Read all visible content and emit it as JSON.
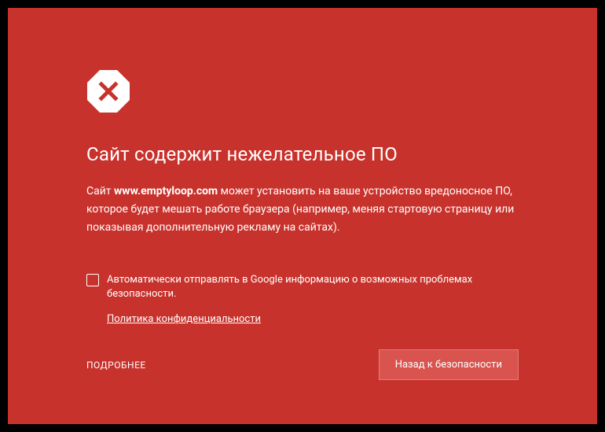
{
  "heading": "Сайт содержит нежелательное ПО",
  "description_prefix": "Сайт ",
  "domain": "www.emptyloop.com",
  "description_suffix": " может установить на ваше устройство вредоносное ПО, которое будет мешать работе браузера (например, меняя стартовую страницу или показывая дополнительную рекламу на сайтах).",
  "checkbox_label": "Автоматически отправлять в Google информацию о возможных проблемах безопасности.",
  "privacy_link": "Политика конфиденциальности",
  "details_link": "ПОДРОБНЕЕ",
  "safety_button": "Назад к безопасности"
}
